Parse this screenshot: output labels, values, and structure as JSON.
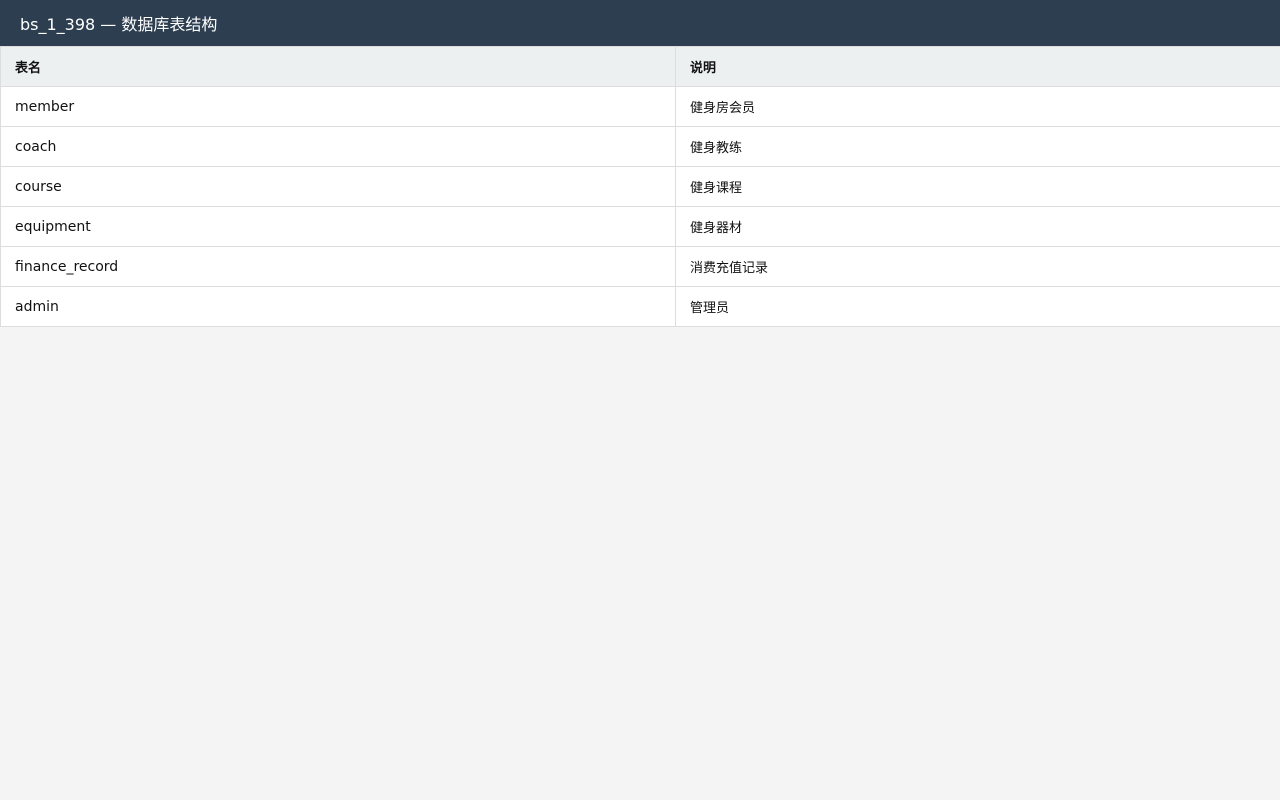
{
  "header": {
    "title": "bs_1_398 — 数据库表结构"
  },
  "table": {
    "columns": [
      "表名",
      "说明"
    ],
    "rows": [
      {
        "name": "member",
        "desc": "健身房会员"
      },
      {
        "name": "coach",
        "desc": "健身教练"
      },
      {
        "name": "course",
        "desc": "健身课程"
      },
      {
        "name": "equipment",
        "desc": "健身器材"
      },
      {
        "name": "finance_record",
        "desc": "消费充值记录"
      },
      {
        "name": "admin",
        "desc": "管理员"
      }
    ]
  },
  "colors": {
    "header_bg": "#2c3e50",
    "table_head_bg": "#ecf0f1",
    "page_bg": "#f4f4f4",
    "border": "#dddddd"
  }
}
